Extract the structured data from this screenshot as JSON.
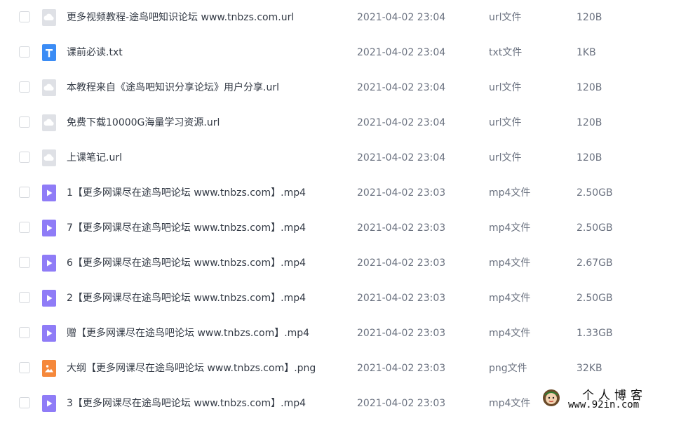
{
  "files": [
    {
      "name": "更多视频教程-途鸟吧知识论坛 www.tnbzs.com.url",
      "date": "2021-04-02 23:04",
      "type": "url文件",
      "size": "120B",
      "icon": "url-file-icon"
    },
    {
      "name": "课前必读.txt",
      "date": "2021-04-02 23:04",
      "type": "txt文件",
      "size": "1KB",
      "icon": "txt-file-icon"
    },
    {
      "name": "本教程来自《途鸟吧知识分享论坛》用户分享.url",
      "date": "2021-04-02 23:04",
      "type": "url文件",
      "size": "120B",
      "icon": "url-file-icon"
    },
    {
      "name": "免费下载10000G海量学习资源.url",
      "date": "2021-04-02 23:04",
      "type": "url文件",
      "size": "120B",
      "icon": "url-file-icon"
    },
    {
      "name": "上课笔记.url",
      "date": "2021-04-02 23:04",
      "type": "url文件",
      "size": "120B",
      "icon": "url-file-icon"
    },
    {
      "name": "1【更多网课尽在途鸟吧论坛 www.tnbzs.com】.mp4",
      "date": "2021-04-02 23:03",
      "type": "mp4文件",
      "size": "2.50GB",
      "icon": "video-file-icon"
    },
    {
      "name": "7【更多网课尽在途鸟吧论坛 www.tnbzs.com】.mp4",
      "date": "2021-04-02 23:03",
      "type": "mp4文件",
      "size": "2.50GB",
      "icon": "video-file-icon"
    },
    {
      "name": "6【更多网课尽在途鸟吧论坛 www.tnbzs.com】.mp4",
      "date": "2021-04-02 23:03",
      "type": "mp4文件",
      "size": "2.67GB",
      "icon": "video-file-icon"
    },
    {
      "name": "2【更多网课尽在途鸟吧论坛 www.tnbzs.com】.mp4",
      "date": "2021-04-02 23:03",
      "type": "mp4文件",
      "size": "2.50GB",
      "icon": "video-file-icon"
    },
    {
      "name": "赠【更多网课尽在途鸟吧论坛 www.tnbzs.com】.mp4",
      "date": "2021-04-02 23:03",
      "type": "mp4文件",
      "size": "1.33GB",
      "icon": "video-file-icon"
    },
    {
      "name": "大纲【更多网课尽在途鸟吧论坛 www.tnbzs.com】.png",
      "date": "2021-04-02 23:03",
      "type": "png文件",
      "size": "32KB",
      "icon": "image-file-icon"
    },
    {
      "name": "3【更多网课尽在途鸟吧论坛 www.tnbzs.com】.mp4",
      "date": "2021-04-02 23:03",
      "type": "mp4文件",
      "size": "",
      "icon": "video-file-icon"
    }
  ],
  "colors": {
    "url_icon": "#dfe1e6",
    "txt_icon": "#3b8cf5",
    "video_icon": "#8f7cf7",
    "image_icon": "#f5883b"
  },
  "watermark": {
    "title": "个人博客",
    "url": "www.92in.com"
  }
}
